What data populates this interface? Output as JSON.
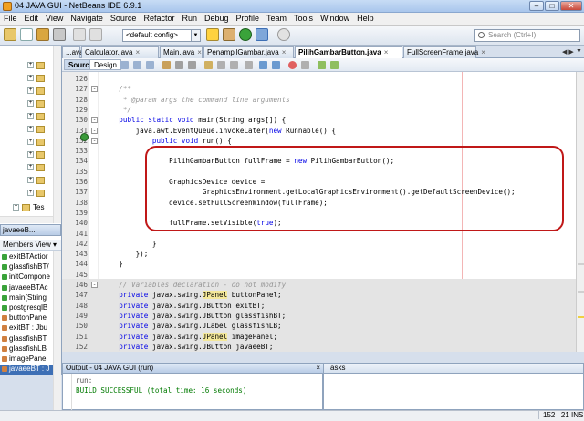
{
  "window": {
    "title": "04 JAVA GUI - NetBeans IDE 6.9.1"
  },
  "menu": [
    "File",
    "Edit",
    "View",
    "Navigate",
    "Source",
    "Refactor",
    "Run",
    "Debug",
    "Profile",
    "Team",
    "Tools",
    "Window",
    "Help"
  ],
  "toolbar": {
    "config": "<default config>",
    "search_placeholder": "Search (Ctrl+I)"
  },
  "project_tree": [
    "Tes"
  ],
  "members": {
    "header": "javaeeB...",
    "title": "Members View",
    "items": [
      "exitBTActior",
      "glassfishBT/",
      "initCompone",
      "javaeeBTAc",
      "main(String",
      "postgresqlB",
      "buttonPane",
      "exitBT : Jbu",
      "glassfishBT",
      "glassfishLB",
      "imagePanel",
      "javaeeBT : J"
    ],
    "selected": 11
  },
  "tabs": [
    {
      "label": "...ava"
    },
    {
      "label": "Calculator.java"
    },
    {
      "label": "Main.java"
    },
    {
      "label": "PenampilGambar.java"
    },
    {
      "label": "PilihGambarButton.java",
      "active": true
    },
    {
      "label": "FullScreenFrame.java"
    }
  ],
  "editor_modes": {
    "source": "Source",
    "design": "Design"
  },
  "code_lines": [
    {
      "n": "126",
      "t": ""
    },
    {
      "n": "127",
      "t": "    /**"
    },
    {
      "n": "128",
      "t": "     * @param args the command line arguments"
    },
    {
      "n": "129",
      "t": "     */"
    },
    {
      "n": "130",
      "t": "    public static void main(String args[]) {"
    },
    {
      "n": "131",
      "t": "        java.awt.EventQueue.invokeLater(new Runnable() {"
    },
    {
      "n": "132",
      "t": "            public void run() {"
    },
    {
      "n": "133",
      "t": ""
    },
    {
      "n": "134",
      "t": "                PilihGambarButton fullFrame = new PilihGambarButton();"
    },
    {
      "n": "135",
      "t": ""
    },
    {
      "n": "136",
      "t": "                GraphicsDevice device ="
    },
    {
      "n": "137",
      "t": "                        GraphicsEnvironment.getLocalGraphicsEnvironment().getDefaultScreenDevice();"
    },
    {
      "n": "138",
      "t": "                device.setFullScreenWindow(fullFrame);"
    },
    {
      "n": "139",
      "t": ""
    },
    {
      "n": "140",
      "t": "                fullFrame.setVisible(true);"
    },
    {
      "n": "141",
      "t": ""
    },
    {
      "n": "142",
      "t": "            }"
    },
    {
      "n": "143",
      "t": "        });"
    },
    {
      "n": "144",
      "t": "    }"
    },
    {
      "n": "145",
      "t": ""
    },
    {
      "n": "146",
      "t": "    // Variables declaration - do not modify"
    },
    {
      "n": "147",
      "t": "    private javax.swing.JPanel buttonPanel;"
    },
    {
      "n": "148",
      "t": "    private javax.swing.JButton exitBT;"
    },
    {
      "n": "149",
      "t": "    private javax.swing.JButton glassfishBT;"
    },
    {
      "n": "150",
      "t": "    private javax.swing.JLabel glassfishLB;"
    },
    {
      "n": "151",
      "t": "    private javax.swing.JPanel imagePanel;"
    },
    {
      "n": "152",
      "t": "    private javax.swing.JButton javaeeBT;"
    }
  ],
  "output": {
    "title": "Output - 04 JAVA GUI (run)",
    "lines": [
      "run:",
      "BUILD SUCCESSFUL (total time: 16 seconds)"
    ]
  },
  "tasks": {
    "title": "Tasks"
  },
  "status": {
    "position": "152 | 21",
    "mode": "INS"
  },
  "colors": {
    "keyword": "#0000e6",
    "comment": "#969696",
    "success": "#007a00",
    "highlight_box": "#c01818"
  }
}
